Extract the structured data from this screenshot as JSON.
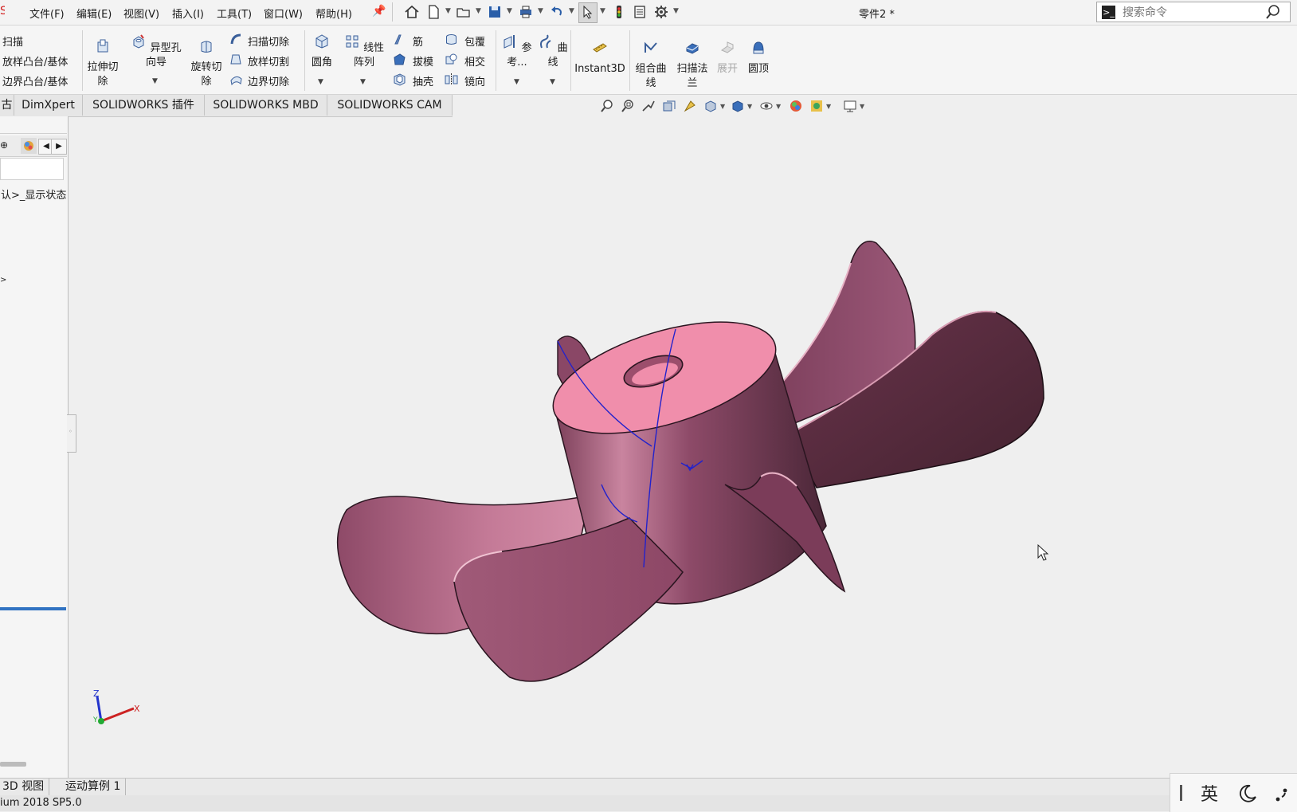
{
  "menubar": {
    "items": [
      "文件(F)",
      "编辑(E)",
      "视图(V)",
      "插入(I)",
      "工具(T)",
      "窗口(W)",
      "帮助(H)"
    ],
    "document_title": "零件2 *",
    "search_placeholder": "搜索命令"
  },
  "ribbon": {
    "sweep_group": [
      "扫描",
      "放样凸台/基体",
      "边界凸台/基体"
    ],
    "extrude_cut": "拉伸切除",
    "hole_wizard": "异型孔向导",
    "revolve_cut": "旋转切除",
    "cut_group": [
      "扫描切除",
      "放样切割",
      "边界切除"
    ],
    "fillet": "圆角",
    "linear_pattern": "线性阵列",
    "feature_group_a": [
      "筋",
      "拔模",
      "抽壳"
    ],
    "feature_group_b": [
      "包覆",
      "相交",
      "镜向"
    ],
    "reference": "参考...",
    "curves": "曲线",
    "instant3d": "Instant3D",
    "composite_curve": "组合曲线",
    "sweep_flange": "扫描法兰",
    "unfold": "展开",
    "dome": "圆顶"
  },
  "tabs": [
    "古",
    "DimXpert",
    "SOLIDWORKS 插件",
    "SOLIDWORKS MBD",
    "SOLIDWORKS CAM"
  ],
  "left_panel": {
    "display_state": "认>_显示状态"
  },
  "bottom_tabs": [
    "3D 视图",
    "运动算例 1"
  ],
  "status_bar": "ium 2018 SP5.0",
  "ime": {
    "language": "英"
  },
  "triad": {
    "z": "Z",
    "x": "X",
    "y": "Y"
  }
}
